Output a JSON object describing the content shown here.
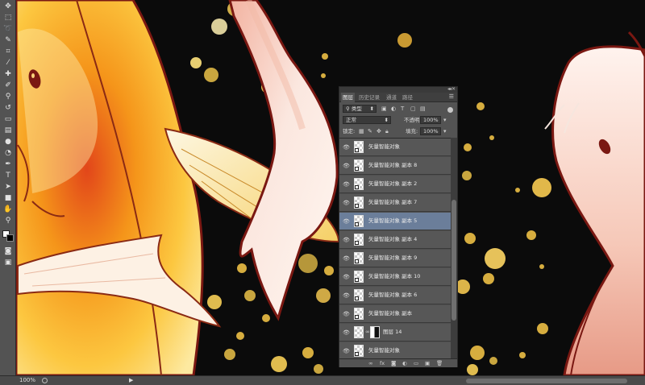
{
  "status": {
    "zoom": "100%"
  },
  "layers_panel": {
    "tabs": [
      "图层",
      "历史记录",
      "通道",
      "路径"
    ],
    "active_tab": 0,
    "filter_kind": "类型",
    "blend_mode": "正常",
    "opacity_label": "不透明度:",
    "opacity_value": "100%",
    "lock_label": "锁定:",
    "fill_label": "填充:",
    "fill_value": "100%",
    "layers": [
      {
        "name": "矢量智能对象",
        "type": "smart-object",
        "visible": true,
        "selected": false
      },
      {
        "name": "矢量智能对象 副本 8",
        "type": "smart-object",
        "visible": true,
        "selected": false
      },
      {
        "name": "矢量智能对象 副本 2",
        "type": "smart-object",
        "visible": true,
        "selected": false
      },
      {
        "name": "矢量智能对象 副本 7",
        "type": "smart-object",
        "visible": true,
        "selected": false
      },
      {
        "name": "矢量智能对象 副本 5",
        "type": "smart-object",
        "visible": true,
        "selected": true
      },
      {
        "name": "矢量智能对象 副本 4",
        "type": "smart-object",
        "visible": true,
        "selected": false
      },
      {
        "name": "矢量智能对象 副本 9",
        "type": "smart-object",
        "visible": true,
        "selected": false
      },
      {
        "name": "矢量智能对象 副本 10",
        "type": "smart-object",
        "visible": true,
        "selected": false
      },
      {
        "name": "矢量智能对象 副本 6",
        "type": "smart-object",
        "visible": true,
        "selected": false
      },
      {
        "name": "矢量智能对象 副本",
        "type": "smart-object",
        "visible": true,
        "selected": false
      },
      {
        "name": "图层 14",
        "type": "layer-with-mask",
        "visible": true,
        "selected": false
      },
      {
        "name": "矢量智能对象",
        "type": "smart-object",
        "visible": true,
        "selected": false
      }
    ],
    "footer_buttons": [
      "link-icon",
      "fx-icon",
      "mask-icon",
      "adjustment-icon",
      "folder-icon",
      "new-layer-icon",
      "trash-icon"
    ]
  },
  "colors": {
    "panel_bg": "#535353",
    "selected_row": "#6b7e9a",
    "canvas_bg": "#0b0b0b",
    "bokeh_gold": "#d8b24a",
    "koi_orange": "#f29a1c",
    "koi_outline": "#7a1812"
  }
}
